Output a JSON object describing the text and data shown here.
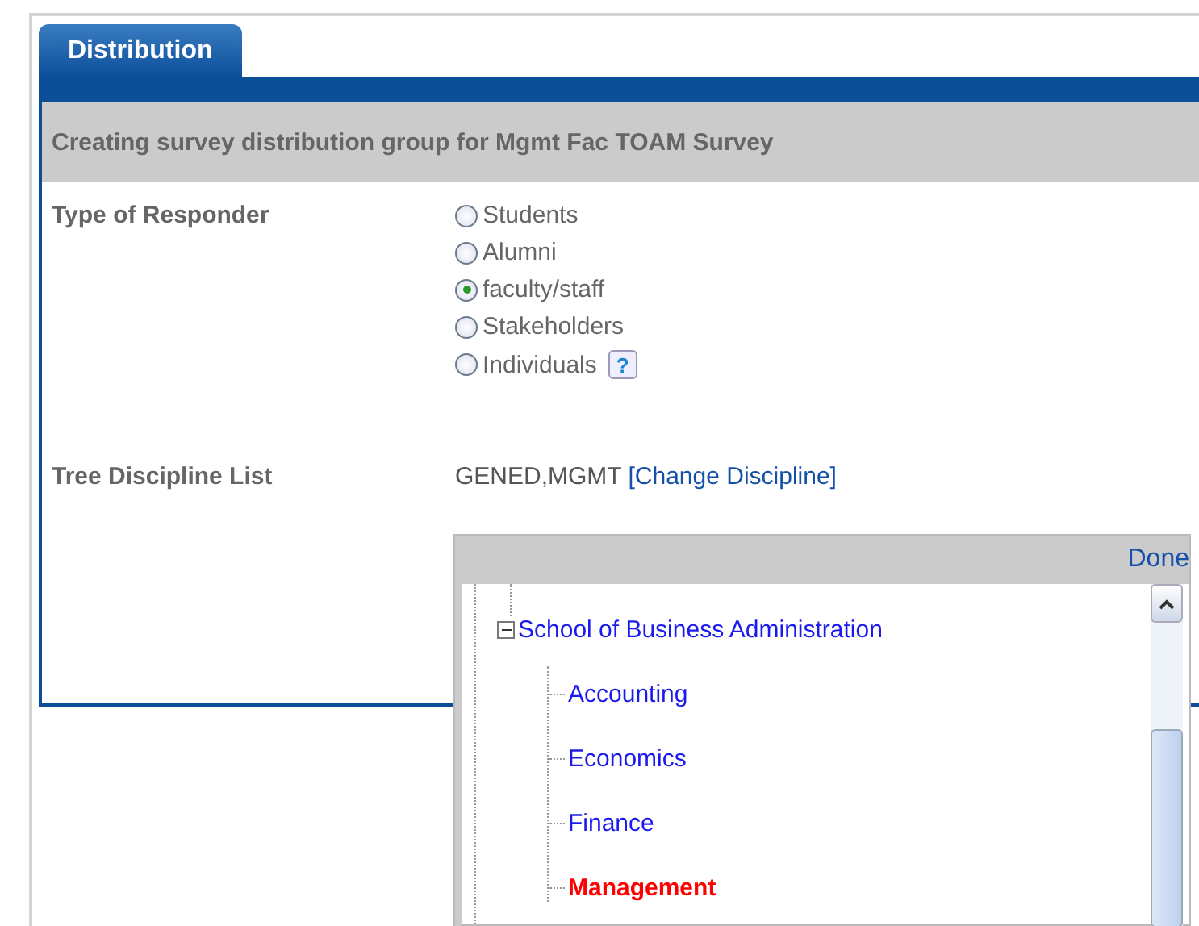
{
  "tabs": [
    {
      "label": "Distribution",
      "selected": true
    }
  ],
  "header": "Creating survey distribution group for Mgmt Fac TOAM Survey",
  "responder": {
    "label": "Type of Responder",
    "options": [
      {
        "label": "Students",
        "selected": false,
        "help": false
      },
      {
        "label": "Alumni",
        "selected": false,
        "help": false
      },
      {
        "label": "faculty/staff",
        "selected": true,
        "help": false
      },
      {
        "label": "Stakeholders",
        "selected": false,
        "help": false
      },
      {
        "label": "Individuals",
        "selected": false,
        "help": true,
        "help_label": "?"
      }
    ]
  },
  "discipline": {
    "label": "Tree Discipline List",
    "value": "GENED,MGMT",
    "link": "[Change Discipline]"
  },
  "tree_popup": {
    "done": "Done",
    "nodes": [
      {
        "label": "School of Business Administration",
        "expanded": true,
        "children": [
          {
            "label": "Accounting",
            "selected": false
          },
          {
            "label": "Economics",
            "selected": false
          },
          {
            "label": "Finance",
            "selected": false
          },
          {
            "label": "Management",
            "selected": true
          }
        ]
      }
    ]
  }
}
